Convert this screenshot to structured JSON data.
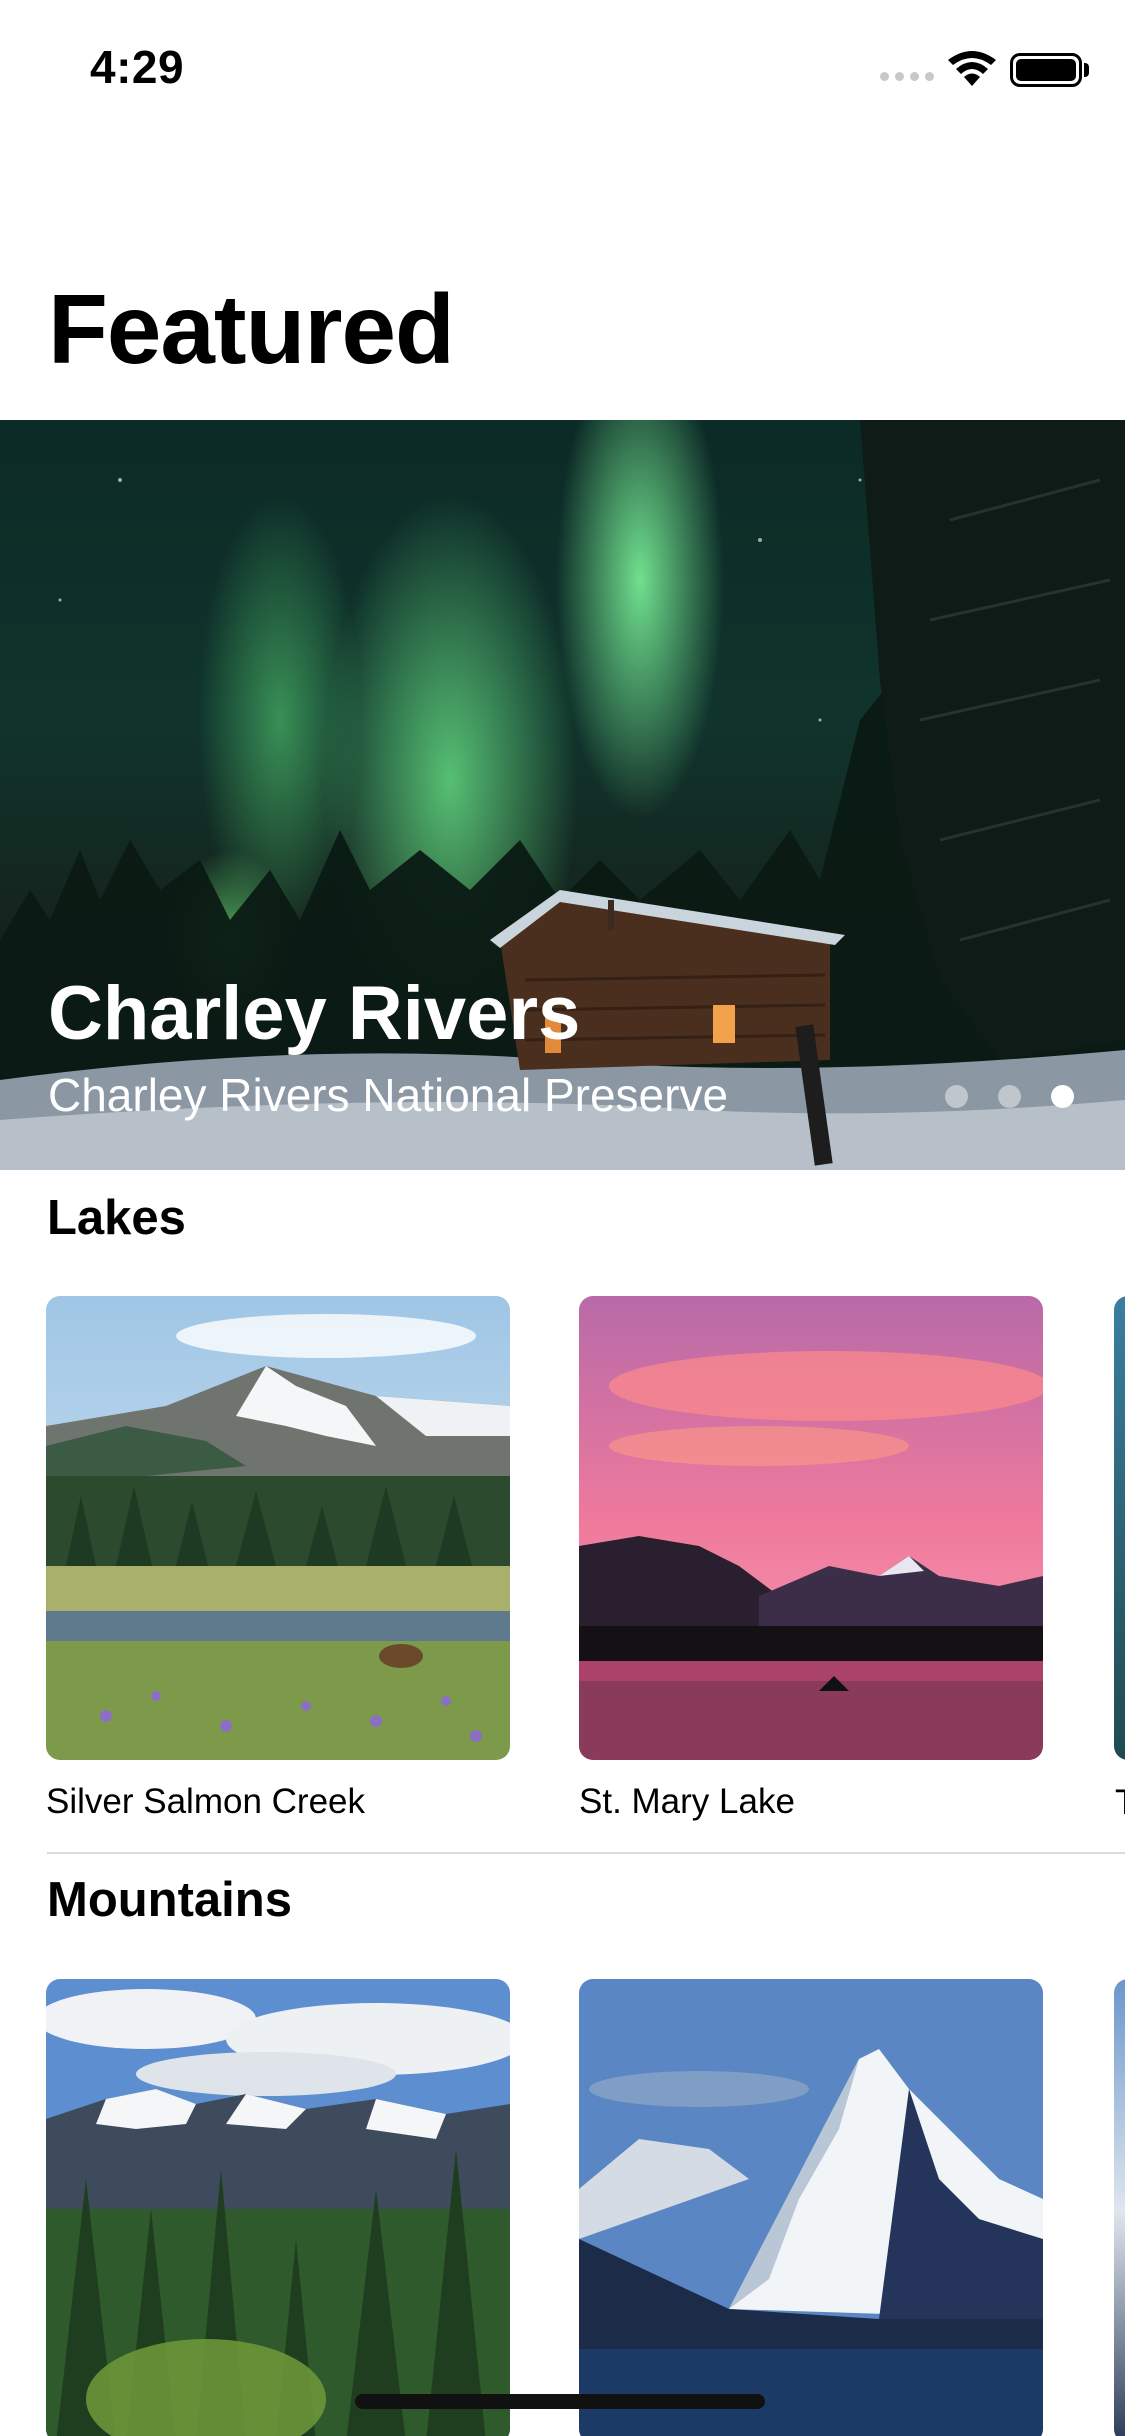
{
  "status_bar": {
    "time": "4:29"
  },
  "page": {
    "title": "Featured"
  },
  "hero": {
    "title": "Charley Rivers",
    "subtitle": "Charley Rivers National Preserve",
    "page_count": 3,
    "active_page": 2
  },
  "sections": [
    {
      "title": "Lakes",
      "items": [
        {
          "label": "Silver Salmon Creek",
          "image": "mountain-meadow-bear"
        },
        {
          "label": "St. Mary Lake",
          "image": "pink-sunset-lake"
        },
        {
          "label": "T",
          "image": "lake-partial"
        }
      ]
    },
    {
      "title": "Mountains",
      "items": [
        {
          "label": "",
          "image": "snowy-range-forest"
        },
        {
          "label": "",
          "image": "snow-peak-lake"
        },
        {
          "label": "",
          "image": "mountain-partial"
        }
      ]
    }
  ],
  "colors": {
    "background": "#ffffff",
    "text": "#000000",
    "divider": "#dcdcdc"
  }
}
